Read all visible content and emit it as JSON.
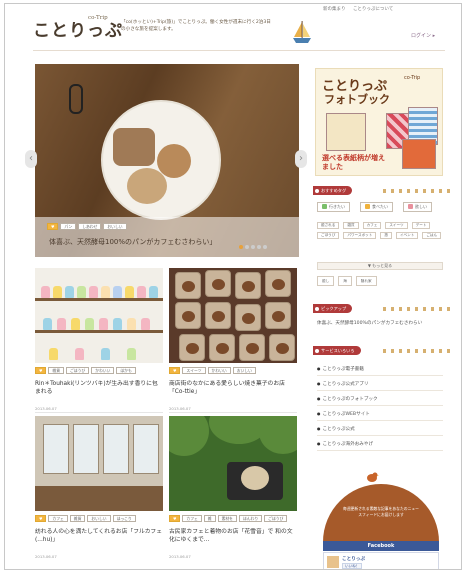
{
  "header": {
    "top_links": [
      "新の集まり",
      "ことりっぷについて"
    ],
    "logo_text": "ことりっぷ",
    "logo_sup": "co-Trip",
    "tagline": "「co(ホッとい)+Trip(旅)」でことりっぷ。働く女性が週末に行く2泊3日の小さな旅を提案します。",
    "login_label": "ログイン ▸"
  },
  "slider": {
    "tags": [
      "♥",
      "パン",
      "しあわせ",
      "おいしい"
    ],
    "title": "体喜ぶ、天然酵母100%のパンがカフェむさわらい」",
    "dots": 5,
    "active_dot": 0,
    "prev": "‹",
    "next": "›"
  },
  "articles": [
    {
      "tags": [
        "♥",
        "雑貨",
        "ごほうび",
        "かわいい",
        "ほかも"
      ],
      "title": "Rin＊Touhaki(リンツバキ)が生み出す香りに包まれる",
      "date": "2013.06.07"
    },
    {
      "tags": [
        "♥",
        "スイーツ",
        "かわいい",
        "おいしい"
      ],
      "title": "商店街のなかにある愛らしい焼き菓子のお店「Co-ttie」",
      "date": "2013.06.07"
    },
    {
      "tags": [
        "♥",
        "カフェ",
        "雑貨",
        "おいしい",
        "ほっこり"
      ],
      "title": "訪れる人の心を満たしてくれるお店「フルカフェ(...hu)」",
      "date": "2013.06.07"
    },
    {
      "tags": [
        "♥",
        "カフェ",
        "雑",
        "素材を",
        "ほんわり",
        "ごほうび"
      ],
      "title": "古民家カフェと着物のお店「花雪音」で 和の文化にゆくまで...",
      "date": "2013.06.07"
    }
  ],
  "sidebar": {
    "banner": {
      "line1": "ことりっぷ",
      "line1_sup": "co-Trip",
      "line2": "フォトブック",
      "line3": "選べる表紙柄が増えました"
    },
    "recommend_tags": {
      "heading": "おすすめタグ",
      "primary": [
        "行きたい",
        "食べたい",
        "欲しい"
      ],
      "chips": [
        "癒される",
        "雑貨",
        "カフェ",
        "スイーツ",
        "デート",
        "ごほうび",
        "パワースポット",
        "旅",
        "イベント",
        "ごはん"
      ],
      "more_label": "▼ もっと見る",
      "mood": [
        "癒し",
        "海",
        "隠れ家"
      ]
    },
    "pickup": {
      "heading": "ピックアップ",
      "item": "体喜ぶ、天然酵母100%のパンがカフェむさわらい"
    },
    "services": {
      "heading": "サービスいろいろ",
      "items": [
        "ことりっぷ電子書籍",
        "ことりっぷ公式アプリ",
        "ことりっぷのフォトブック",
        "ことりっぷWEBサイト",
        "ことりっぷ公式",
        "ことりっぷ海外おみやげ"
      ]
    },
    "newsletter": "毎週更新される素敵な記事をあなたのニュースフィードにお届けします",
    "facebook": {
      "heading": "Facebook",
      "name": "ことりっぷ",
      "like_label": "いいね！"
    }
  },
  "colors": {
    "accent_red": "#b03a3a",
    "tag_favorite": "#f3b540",
    "facebook_blue": "#3b5998"
  }
}
